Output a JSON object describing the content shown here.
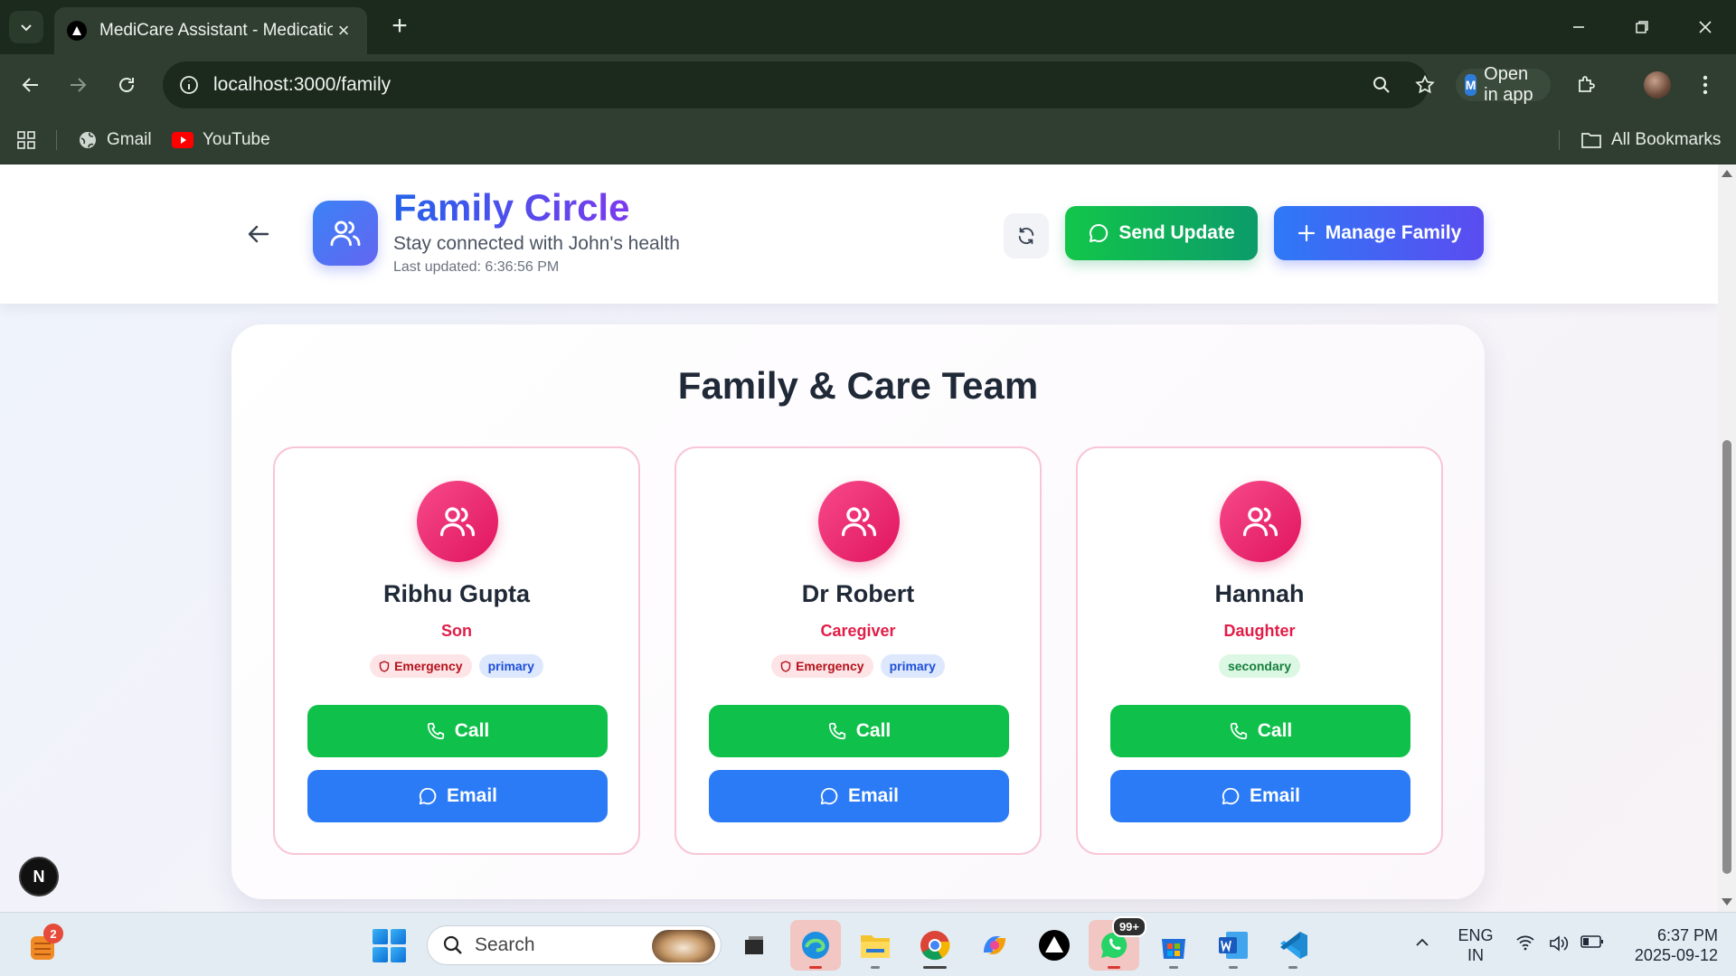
{
  "browser": {
    "tab_title": "MediCare Assistant - Medicatio",
    "url": "localhost:3000/family",
    "open_in_app_label": "Open in app",
    "bookmarks": [
      {
        "label": "Gmail",
        "icon": "globe-icon"
      },
      {
        "label": "YouTube",
        "icon": "youtube-icon"
      }
    ],
    "all_bookmarks_label": "All Bookmarks"
  },
  "header": {
    "title": "Family Circle",
    "subtitle": "Stay connected with John's health",
    "last_updated": "Last updated: 6:36:56 PM",
    "send_update_label": "Send Update",
    "manage_family_label": "Manage Family",
    "brand_color": "#3b82f6"
  },
  "team": {
    "title": "Family & Care Team",
    "call_label": "Call",
    "email_label": "Email",
    "members": [
      {
        "name": "Ribhu Gupta",
        "relation": "Son",
        "emergency": true,
        "emergency_label": "Emergency",
        "priority": "primary"
      },
      {
        "name": "Dr Robert",
        "relation": "Caregiver",
        "emergency": true,
        "emergency_label": "Emergency",
        "priority": "primary"
      },
      {
        "name": "Hannah",
        "relation": "Daughter",
        "emergency": false,
        "emergency_label": "",
        "priority": "secondary"
      }
    ]
  },
  "dev_badge": "N",
  "taskbar": {
    "weather_badge": "2",
    "search_placeholder": "Search",
    "whatsapp_badge": "99+",
    "language": "ENG",
    "region": "IN",
    "time": "6:37 PM",
    "date": "2025-09-12"
  },
  "colors": {
    "call_green": "#0fc14a",
    "email_blue": "#2b7bf6",
    "avatar_pink": "#f74a8a",
    "relation_red": "#e11d48"
  }
}
